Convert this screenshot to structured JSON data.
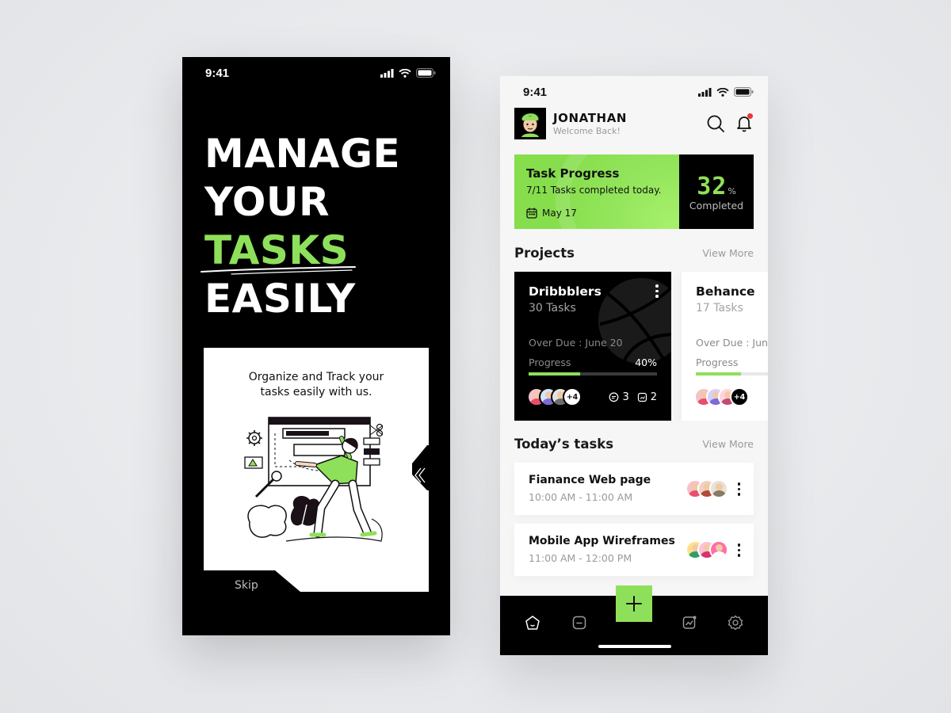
{
  "onboarding": {
    "status_time": "9:41",
    "headline": [
      "MANAGE",
      "YOUR",
      "TASKS",
      "EASILY"
    ],
    "card_text": "Organize and Track your tasks easily with us.",
    "skip_label": "Skip"
  },
  "dashboard": {
    "status_time": "9:41",
    "user": {
      "name": "JONATHAN",
      "greeting": "Welcome Back!"
    },
    "task_progress": {
      "title": "Task Progress",
      "summary": "7/11 Tasks completed today.",
      "date": "May 17",
      "percent": "32",
      "percent_sign": "%",
      "percent_label": "Completed"
    },
    "projects_section": {
      "title": "Projects",
      "link": "View More"
    },
    "projects": [
      {
        "name": "Dribbblers",
        "tasks": "30 Tasks",
        "due": "Over Due : June 20",
        "progress_label": "Progress",
        "progress_value": "40%",
        "progress": 0.4,
        "more_members": "+4",
        "comments": "3",
        "files": "2"
      },
      {
        "name": "Behance",
        "tasks": "17 Tasks",
        "due": "Over Due : June",
        "progress_label": "Progress",
        "progress": 0.35,
        "more_members": "+4"
      }
    ],
    "today_section": {
      "title": "Today’s tasks",
      "link": "View More"
    },
    "today_tasks": [
      {
        "title": "Fianance Web page",
        "time": "10:00 AM - 11:00 AM"
      },
      {
        "title": "Mobile App Wireframes",
        "time": "11:00 AM - 12:00 PM"
      }
    ],
    "bottom_nav": [
      "home-icon",
      "tasks-icon",
      "add-icon",
      "stats-icon",
      "settings-icon"
    ]
  },
  "colors": {
    "accent_green": "#8ee05a",
    "dark": "#000000",
    "notification_red": "#e53935"
  }
}
